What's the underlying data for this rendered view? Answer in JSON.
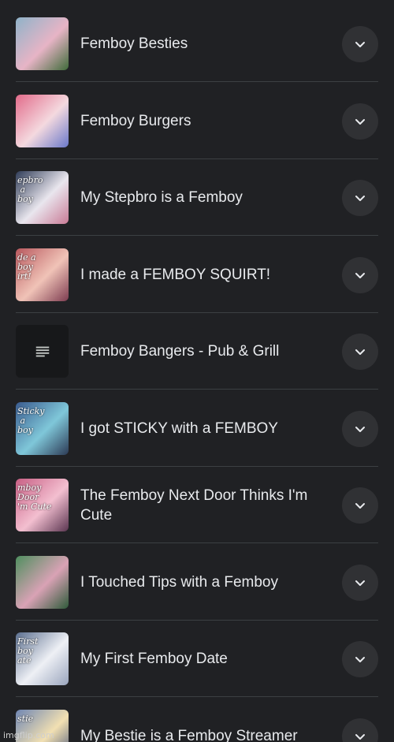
{
  "results": [
    {
      "title": "Femboy Besties",
      "thumb_text": "",
      "thumb_colors": [
        "#8fb3c9",
        "#e7b4c6",
        "#3f6b3a"
      ],
      "thumb_kind": "image"
    },
    {
      "title": "Femboy Burgers",
      "thumb_text": "",
      "thumb_colors": [
        "#e26b8a",
        "#f4d9df",
        "#6a78c9"
      ],
      "thumb_kind": "image"
    },
    {
      "title": "My Stepbro is a Femboy",
      "thumb_text": "epbro\n a\nboy",
      "thumb_colors": [
        "#2f3c57",
        "#e9e6ee",
        "#c97b96"
      ],
      "thumb_kind": "image"
    },
    {
      "title": "I made a FEMBOY SQUIRT!",
      "thumb_text": "de a\nboy\nirt!",
      "thumb_colors": [
        "#b9585e",
        "#f0c3b7",
        "#7d3c50"
      ],
      "thumb_kind": "image"
    },
    {
      "title": "Femboy Bangers - Pub & Grill",
      "thumb_text": "",
      "thumb_colors": [],
      "thumb_kind": "document",
      "icon": "document-icon"
    },
    {
      "title": "I got STICKY with a FEMBOY",
      "thumb_text": "Sticky\n a\nboy",
      "thumb_colors": [
        "#3a5b8f",
        "#7fc7d9",
        "#2c3a55"
      ],
      "thumb_kind": "image"
    },
    {
      "title": "The Femboy Next Door Thinks I'm Cute",
      "thumb_text": "mboy\nDoor\n'm Cute",
      "thumb_colors": [
        "#c85f84",
        "#f3bfd0",
        "#5a3550"
      ],
      "thumb_kind": "image"
    },
    {
      "title": "I Touched Tips with a Femboy",
      "thumb_text": "",
      "thumb_colors": [
        "#4f8f5f",
        "#d9a2b5",
        "#2e5a3a"
      ],
      "thumb_kind": "image"
    },
    {
      "title": "My First Femboy Date",
      "thumb_text": "First\nboy\nate",
      "thumb_colors": [
        "#5b6f8f",
        "#eef0f5",
        "#9aa5bd"
      ],
      "thumb_kind": "image"
    },
    {
      "title": "My Bestie is a Femboy Streamer",
      "thumb_text": "stie",
      "thumb_colors": [
        "#6f86b3",
        "#f2e0b2",
        "#3d4c73"
      ],
      "thumb_kind": "image"
    }
  ],
  "expand_icon": "chevron-down-icon",
  "watermark": "imgflip.com",
  "colors": {
    "background": "#202124",
    "text": "#e8eaed",
    "button": "#303134",
    "divider": "#3c4043"
  }
}
